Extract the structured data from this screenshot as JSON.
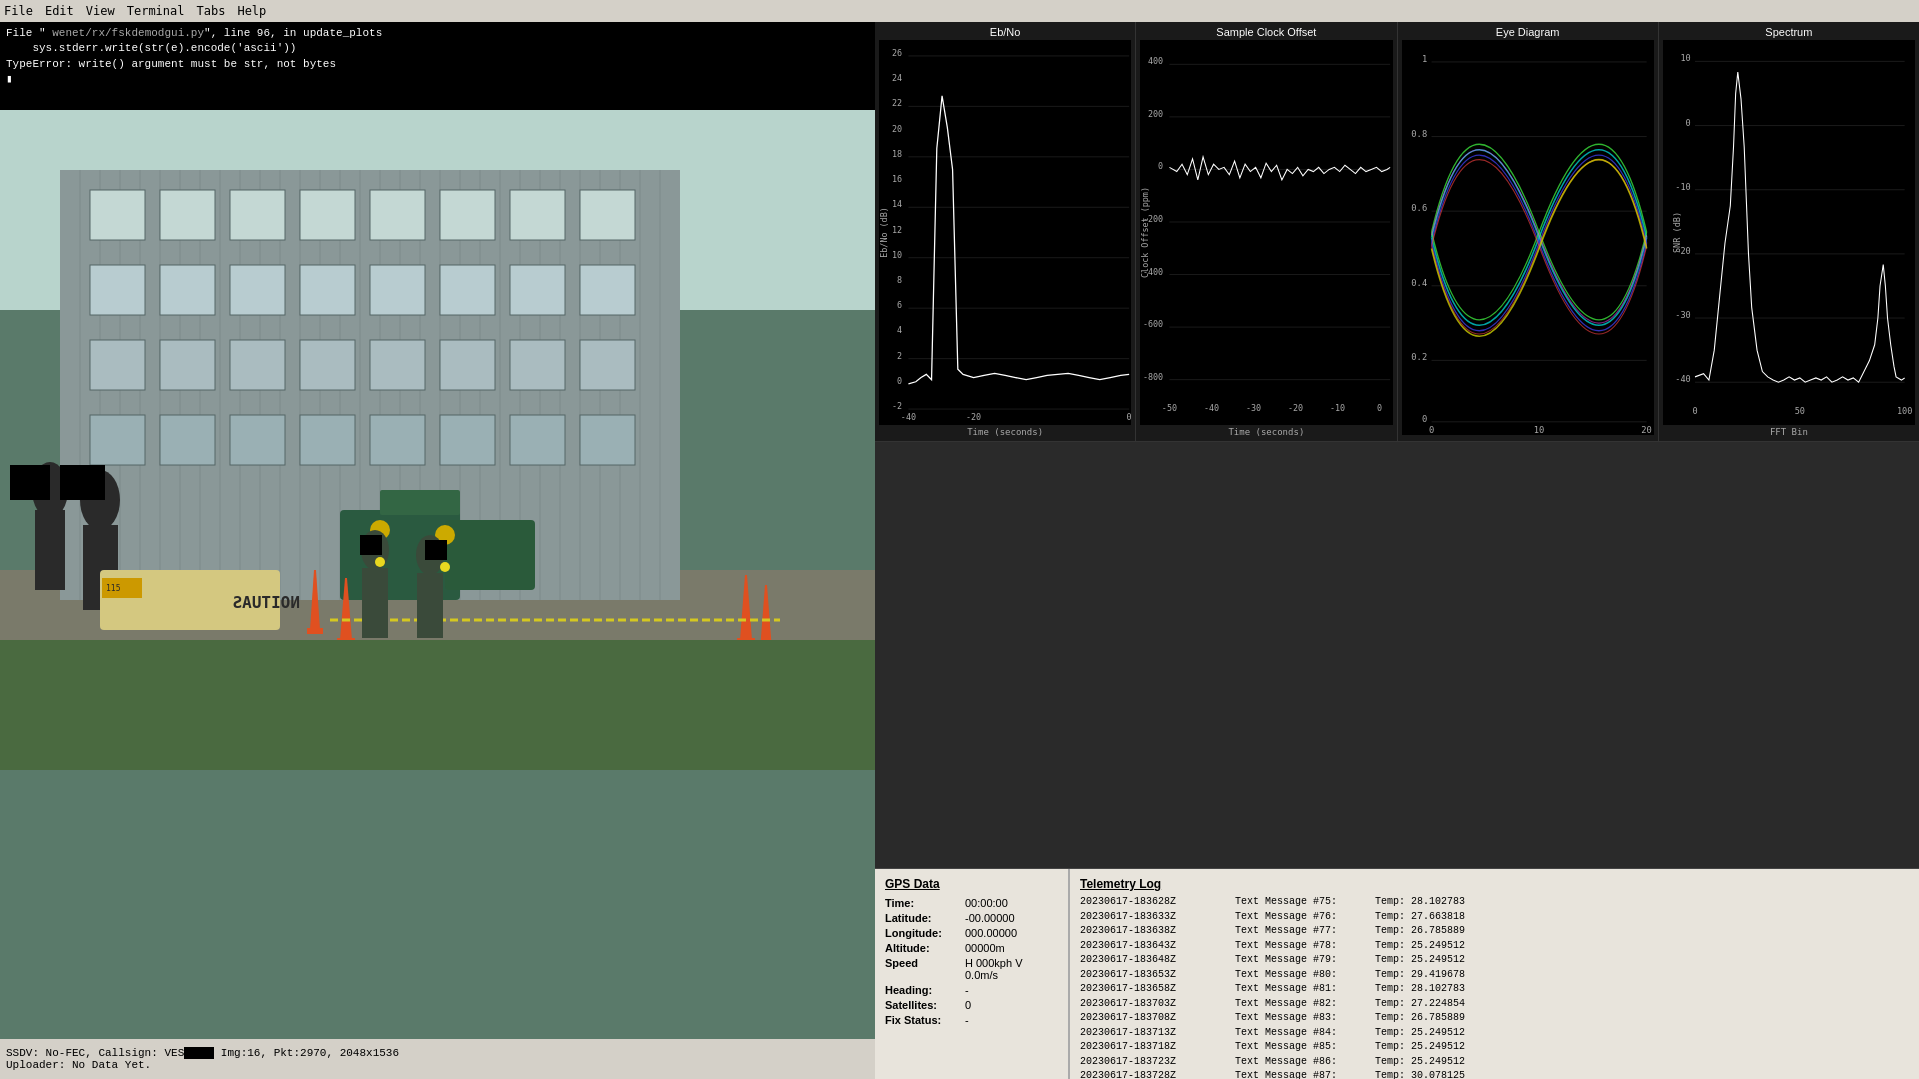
{
  "menubar": {
    "items": [
      "File",
      "Edit",
      "View",
      "Terminal",
      "Tabs",
      "Help"
    ]
  },
  "terminal": {
    "lines": [
      "File \"                  wenet/rx/fskdemodgui.py\", line 96, in update_plots",
      "    sys.stderr.write(str(e).encode('ascii'))",
      "TypeError: write() argument must be str, not bytes",
      " "
    ]
  },
  "status_bar": {
    "line1": "SSDV: No-FEC, Callsign: VES    Img:16, Pkt:2970, 2048x1536",
    "line2": "Uploader: No Data Yet."
  },
  "charts": {
    "ebno": {
      "title": "Eb/No",
      "y_labels": [
        "26",
        "24",
        "22",
        "20",
        "18",
        "16",
        "14",
        "12",
        "10",
        "8",
        "6",
        "4",
        "2",
        "0",
        "-2"
      ],
      "x_label": "Time (seconds)",
      "y_axis_title": "Eb/No (dB)"
    },
    "sample_clock": {
      "title": "Sample Clock Offset",
      "y_labels": [
        "400",
        "200",
        "0",
        "-200",
        "-400",
        "-600",
        "-800"
      ],
      "x_label": "Time (seconds)",
      "y_axis_title": "Clock Offset (ppm)"
    },
    "eye_diagram": {
      "title": "Eye Diagram",
      "y_labels": [
        "1",
        "0.8",
        "0.6",
        "0.4",
        "0.2",
        "0"
      ],
      "x_label": ""
    },
    "spectrum": {
      "title": "Spectrum",
      "y_labels": [
        "10",
        "0",
        "-10",
        "-20",
        "-30",
        "-40"
      ],
      "x_label": "FFT Bin",
      "y_axis_title": "SNR (dB)"
    }
  },
  "gps": {
    "title": "GPS Data",
    "fields": [
      {
        "label": "Time:",
        "value": "00:00:00"
      },
      {
        "label": "Latitude:",
        "value": "-00.00000"
      },
      {
        "label": "Longitude:",
        "value": "000.00000"
      },
      {
        "label": "Altitude:",
        "value": "00000m"
      },
      {
        "label": "Speed",
        "value": "H 000kph V 0.0m/s"
      },
      {
        "label": "Heading:",
        "value": "-"
      },
      {
        "label": "Satellites:",
        "value": "0"
      },
      {
        "label": "Fix Status:",
        "value": "-"
      }
    ]
  },
  "telemetry": {
    "title": "Telemetry Log",
    "entries": [
      {
        "timestamp": "20230617-183628Z",
        "message": "Text Message #75:",
        "value": "Temp: 28.102783"
      },
      {
        "timestamp": "20230617-183633Z",
        "message": "Text Message #76:",
        "value": "Temp: 27.663818"
      },
      {
        "timestamp": "20230617-183638Z",
        "message": "Text Message #77:",
        "value": "Temp: 26.785889"
      },
      {
        "timestamp": "20230617-183643Z",
        "message": "Text Message #78:",
        "value": "Temp: 25.249512"
      },
      {
        "timestamp": "20230617-183648Z",
        "message": "Text Message #79:",
        "value": "Temp: 25.249512"
      },
      {
        "timestamp": "20230617-183653Z",
        "message": "Text Message #80:",
        "value": "Temp: 29.419678"
      },
      {
        "timestamp": "20230617-183658Z",
        "message": "Text Message #81:",
        "value": "Temp: 28.102783"
      },
      {
        "timestamp": "20230617-183703Z",
        "message": "Text Message #82:",
        "value": "Temp: 27.224854"
      },
      {
        "timestamp": "20230617-183708Z",
        "message": "Text Message #83:",
        "value": "Temp: 26.785889"
      },
      {
        "timestamp": "20230617-183713Z",
        "message": "Text Message #84:",
        "value": "Temp: 25.249512"
      },
      {
        "timestamp": "20230617-183718Z",
        "message": "Text Message #85:",
        "value": "Temp: 25.249512"
      },
      {
        "timestamp": "20230617-183723Z",
        "message": "Text Message #86:",
        "value": "Temp: 25.249512"
      },
      {
        "timestamp": "20230617-183728Z",
        "message": "Text Message #87:",
        "value": "Temp: 30.078125"
      }
    ]
  }
}
